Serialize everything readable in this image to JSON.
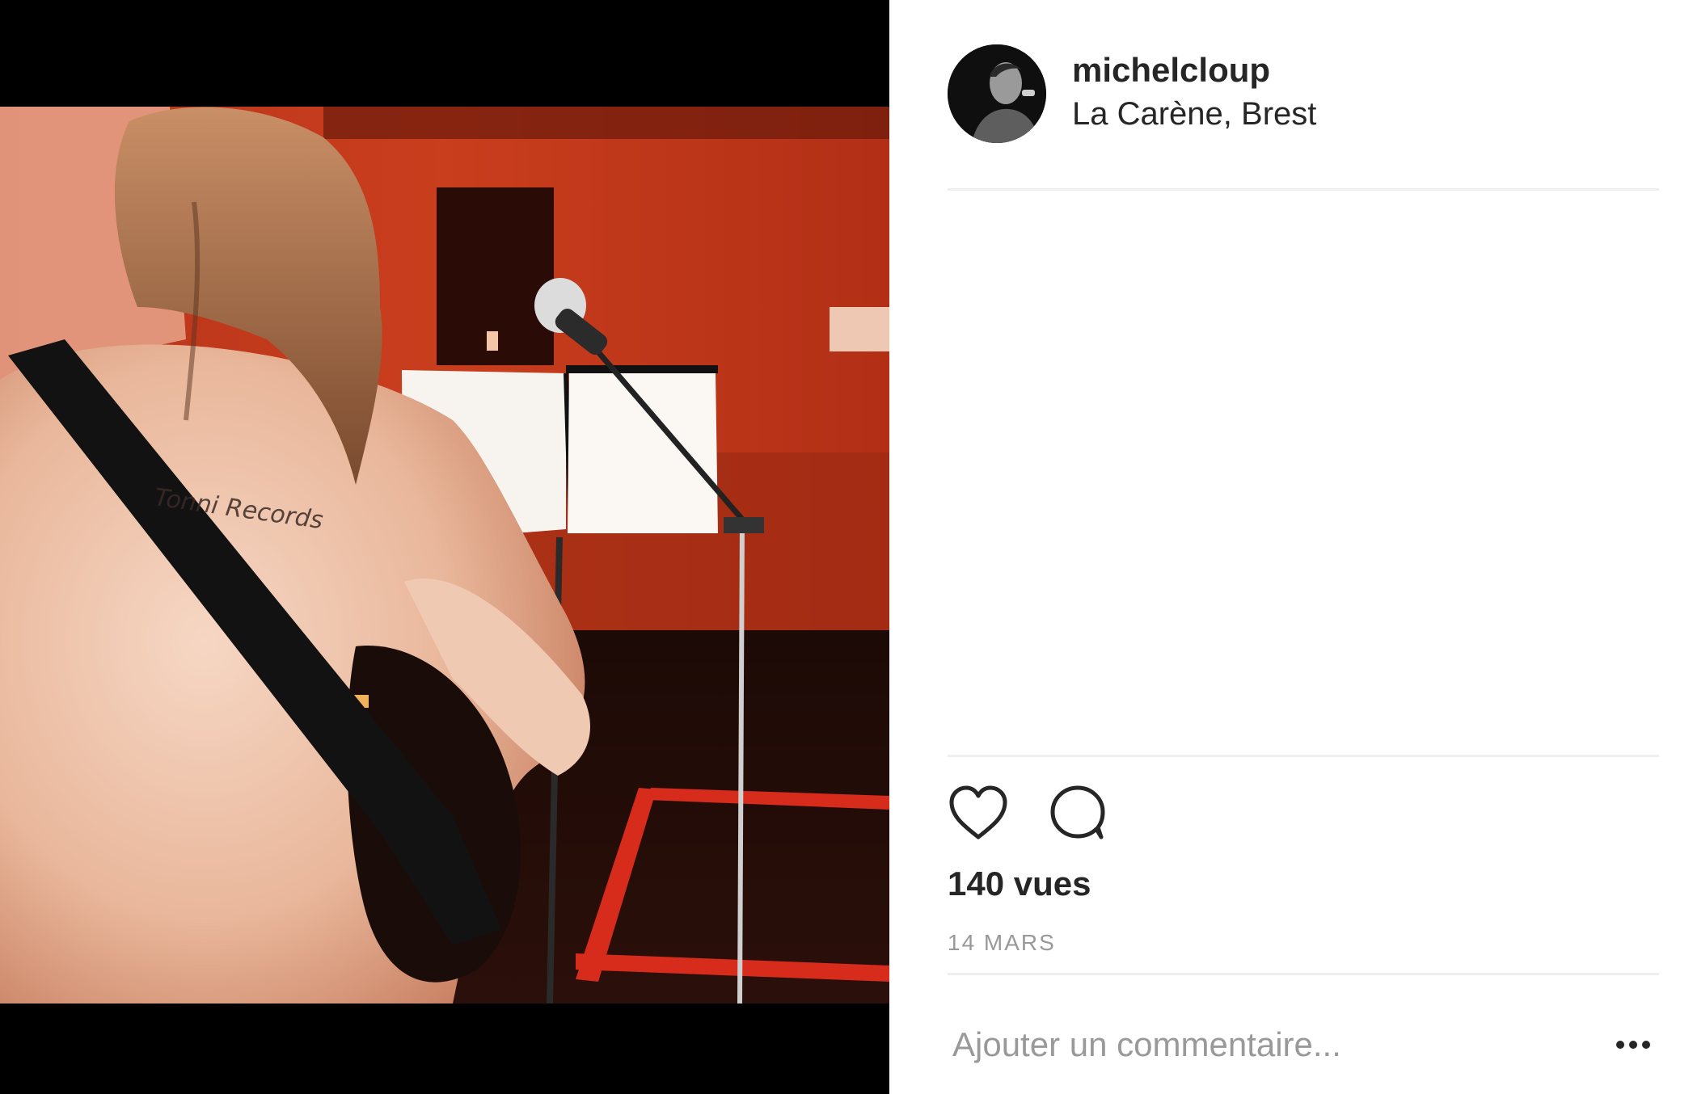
{
  "post": {
    "username": "michelcloup",
    "location": "La Carène, Brest",
    "views": "140 vues",
    "date": "14 MARS"
  },
  "media": {
    "shirt_text": "Tonni Records"
  },
  "actions": {
    "like_icon": "heart-icon",
    "comment_icon": "speech-bubble-icon",
    "more_icon": "ellipsis-icon"
  },
  "comment_box": {
    "placeholder": "Ajouter un commentaire..."
  },
  "colors": {
    "text_primary": "#262626",
    "text_secondary": "#999999",
    "divider": "#efefef",
    "wall_red": "#c2331a"
  }
}
